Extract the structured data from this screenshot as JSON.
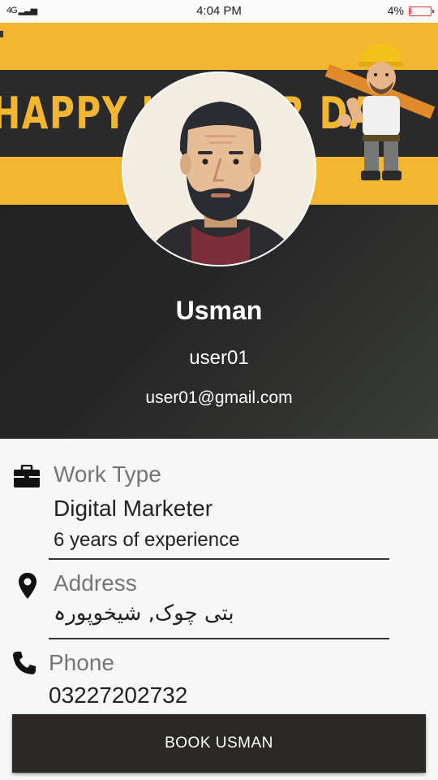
{
  "status_bar": {
    "signal_text": "4G",
    "time": "4:04 PM",
    "battery_percent": "4%",
    "battery_level": 0.04
  },
  "banner": {
    "text": "HAPPY LABOUR DAY",
    "color": "#f2b630"
  },
  "profile": {
    "name": "Usman",
    "username": "user01",
    "email": "user01@gmail.com"
  },
  "work_type": {
    "label": "Work Type",
    "icon": "briefcase-icon",
    "value": "Digital Marketer",
    "experience": "6 years of experience"
  },
  "address": {
    "label": "Address",
    "icon": "location-pin-icon",
    "value": "بتی چوک, شیخوپورہ"
  },
  "phone": {
    "label": "Phone",
    "icon": "phone-icon",
    "value": "03227202732"
  },
  "actions": {
    "book_label": "BOOK USMAN"
  }
}
